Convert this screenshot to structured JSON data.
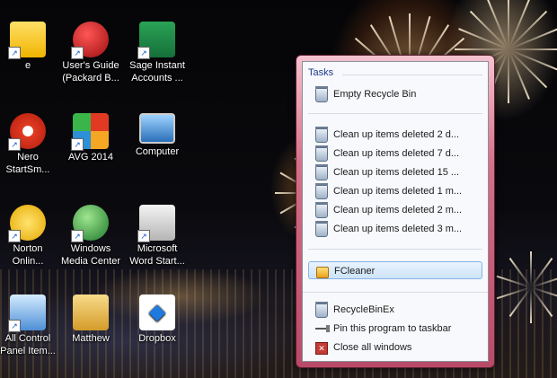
{
  "desktop_icons": [
    {
      "name": "ebay-icon",
      "label": "e",
      "color": "#ffd23d"
    },
    {
      "name": "users-guide-icon",
      "label": "User's Guide\n(Packard B...",
      "color": "#c81e1e"
    },
    {
      "name": "sage-icon",
      "label": "Sage Instant\nAccounts ...",
      "color": "#1c8a3e"
    },
    {
      "name": "nero-icon",
      "label": "Nero\nStartSm...",
      "color": "#e23a22"
    },
    {
      "name": "avg-icon",
      "label": "AVG 2014",
      "color": "#e25b1c"
    },
    {
      "name": "computer-icon",
      "label": "Computer",
      "color": "#3c8fd8"
    },
    {
      "name": "norton-icon",
      "label": "Norton\nOnlin...",
      "color": "#f2c200"
    },
    {
      "name": "windows-media-center-icon",
      "label": "Windows\nMedia Center",
      "color": "#3a9a3a"
    },
    {
      "name": "word-starter-icon",
      "label": "Microsoft\nWord Start...",
      "color": "#d9d9d9"
    },
    {
      "name": "control-panel-icon",
      "label": "All Control\nPanel Item...",
      "color": "#5a9fe0"
    },
    {
      "name": "user-folder-icon",
      "label": "Matthew",
      "color": "#e8c36a"
    },
    {
      "name": "dropbox-icon",
      "label": "Dropbox",
      "color": "#ffffff"
    }
  ],
  "jumplist": {
    "tasks_title": "Tasks",
    "empty_recycle": "Empty Recycle Bin",
    "cleanup": [
      "Clean up items deleted 2 d...",
      "Clean up items deleted 7 d...",
      "Clean up items deleted 15 ...",
      "Clean up items deleted 1 m...",
      "Clean up items deleted 2 m...",
      "Clean up items deleted 3 m..."
    ],
    "fcleaner": "FCleaner",
    "program_name": "RecycleBinEx",
    "pin": "Pin this program to taskbar",
    "close_all": "Close all windows"
  },
  "colors": {
    "frame_accent": "#d66f88",
    "selected_item": "#cde3f9",
    "section_title": "#1e3a8a"
  }
}
